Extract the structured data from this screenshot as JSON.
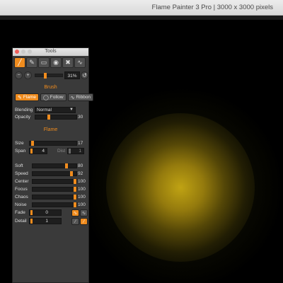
{
  "window": {
    "title": "Flame Painter 3 Pro | 3000 x 3000 pixels"
  },
  "panel": {
    "title": "Tools",
    "tools": [
      {
        "name": "flame-brush-tool-icon",
        "glyph": "╱",
        "active": true
      },
      {
        "name": "pen-tool-icon",
        "glyph": "✎",
        "active": false
      },
      {
        "name": "eraser-tool-icon",
        "glyph": "▭",
        "active": false
      },
      {
        "name": "color-drop-tool-icon",
        "glyph": "◉",
        "active": false
      },
      {
        "name": "transform-tool-icon",
        "glyph": "✖",
        "active": false
      },
      {
        "name": "wave-tool-icon",
        "glyph": "∿",
        "active": false
      }
    ],
    "zoom": {
      "value": "31%",
      "level": 0.31
    },
    "brush": {
      "section_title": "Brush",
      "modes": [
        {
          "label": "Flame",
          "active": true
        },
        {
          "label": "Follow",
          "active": false
        },
        {
          "label": "Ribbon",
          "active": false
        }
      ],
      "blending": {
        "label": "Blending",
        "value": "Normal"
      },
      "opacity": {
        "label": "Opacity",
        "value": "30",
        "level": 0.3
      }
    },
    "flame": {
      "section_title": "Flame",
      "size": {
        "label": "Size",
        "value": "17",
        "level": 0.03
      },
      "span": {
        "label": "Span",
        "value": "4"
      },
      "dist": {
        "label": "Dist",
        "value": "1"
      },
      "sliders": [
        {
          "key": "soft",
          "label": "Soft",
          "value": "80",
          "level": 0.8
        },
        {
          "key": "speed",
          "label": "Speed",
          "value": "92",
          "level": 0.92
        },
        {
          "key": "center",
          "label": "Center",
          "value": "100",
          "level": 1.0
        },
        {
          "key": "focus",
          "label": "Focus",
          "value": "100",
          "level": 1.0
        },
        {
          "key": "chaos",
          "label": "Chaos",
          "value": "100",
          "level": 1.0
        },
        {
          "key": "noise",
          "label": "Noise",
          "value": "100",
          "level": 1.0
        }
      ],
      "fade": {
        "label": "Fade",
        "value": "0"
      },
      "detail": {
        "label": "Detail",
        "value": "1"
      }
    }
  },
  "colors": {
    "accent": "#f08c1e",
    "panel_bg": "#3a3a3a",
    "flame": "#c8aa14"
  }
}
